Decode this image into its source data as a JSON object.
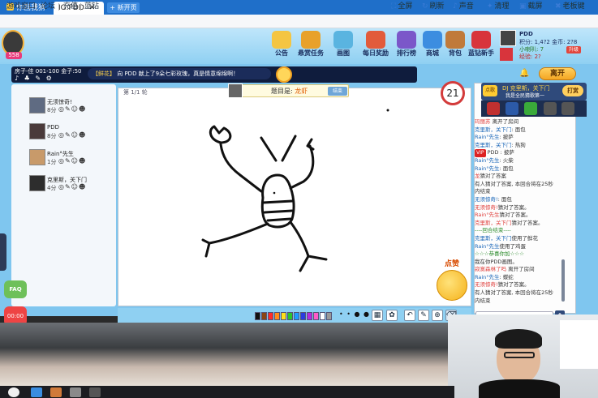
{
  "browser": {
    "tabs": [
      {
        "label": "你画我猜",
        "active": false
      },
      {
        "label": "IG.PDD",
        "active": true
      }
    ],
    "new_tab_label": "+ 新开页面"
  },
  "menubar": {
    "left_items": [
      "游戏窗口",
      "论坛",
      "充值",
      "蓝钻"
    ],
    "tools": [
      {
        "label": "全屏",
        "icon": "fullscreen-icon"
      },
      {
        "label": "刷新",
        "icon": "refresh-icon"
      },
      {
        "label": "声音",
        "icon": "sound-icon"
      },
      {
        "label": "清理",
        "icon": "broom-icon"
      },
      {
        "label": "截屏",
        "icon": "camera-icon"
      },
      {
        "label": "老板键",
        "icon": "boss-key-icon"
      }
    ]
  },
  "nav": {
    "items": [
      {
        "label": "公告",
        "color": "#f4c542"
      },
      {
        "label": "悬赏任务",
        "color": "#e8a12a"
      },
      {
        "label": "画图",
        "color": "#5ab4e0"
      },
      {
        "label": "每日奖励",
        "color": "#e25b3b"
      },
      {
        "label": "排行榜",
        "color": "#7b57c9"
      },
      {
        "label": "商城",
        "color": "#3c8de0"
      },
      {
        "label": "背包",
        "color": "#c07a3a"
      },
      {
        "label": "蓝钻新手",
        "color": "#d8343c"
      }
    ]
  },
  "avatar_tag": "558",
  "profile": {
    "name": "PDD",
    "line1": "积分: 1,4?2  金币: 2?8",
    "line2": "小喇叭: 7",
    "line3": "经验: 2?",
    "badge": "升级"
  },
  "room": {
    "info": "房子-佳 001-100 金子:50",
    "icons": "♪ ♣ ✎ ⚙"
  },
  "marquee": {
    "prefix": "【鲜花】",
    "text": "向 PDD 献上了9朵七彩玫瑰，真是情意绵绵啊！"
  },
  "leave_label": "离开",
  "players": [
    {
      "name": "无须惊奇!",
      "score": "8分",
      "ava": "#5f6b82"
    },
    {
      "name": "PDD",
      "score": "8分",
      "ava": "#4a3a3a"
    },
    {
      "name": "Rain°先生",
      "score": "1分",
      "ava": "#c89a6a"
    },
    {
      "name": "克里斯，关下门",
      "score": "4分",
      "ava": "#2d2d2d"
    }
  ],
  "player_tools": "◎✎☺☻",
  "canvas": {
    "round": "第 1/1 轮",
    "hint_prefix": "题目是: ",
    "hint_answer": "龙虾",
    "hint_button": "结束",
    "timer": "21"
  },
  "palette": [
    "#111111",
    "#8b4513",
    "#ff2a2a",
    "#ff8c1a",
    "#ffe01a",
    "#2bc52b",
    "#1e9bff",
    "#2a3de0",
    "#b52ae0",
    "#ff5ac8",
    "#ffffff",
    "#999999"
  ],
  "brush_dots": "• • ● ●",
  "tool_buttons": [
    "↶",
    "✎",
    "⊕",
    "⌫"
  ],
  "side": {
    "faq": "FAQ",
    "clock": "00:00"
  },
  "chat": {
    "header_name": "DJ 克里斯，关下门",
    "header_sub": "我是全民猜歌第一",
    "header_tag": "点歌",
    "gift_button": "打赏",
    "messages": [
      {
        "who": "玛丽苏",
        "text": "  离开了房间",
        "cls": "r"
      },
      {
        "who": "克里斯，关下门",
        "text": ": 面包",
        "cls": "n"
      },
      {
        "who": "Rain°先生",
        "text": ": 披萨",
        "cls": "n"
      },
      {
        "who": "克里斯，关下门",
        "text": ": 热狗",
        "cls": "n"
      },
      {
        "who": "VIP",
        "text": " PDD : 披萨",
        "cls": "vip"
      },
      {
        "who": "Rain°先生",
        "text": ": 火柴",
        "cls": "n"
      },
      {
        "who": "Rain°先生",
        "text": ": 面包",
        "cls": "n"
      },
      {
        "who": "龙",
        "text": "猜对了答案",
        "cls": "r"
      },
      {
        "who": "",
        "text": "有人猜对了答案, 本回合将在25秒",
        "cls": ""
      },
      {
        "who": "",
        "text": "内结束",
        "cls": ""
      },
      {
        "who": "无须惊奇!",
        "text": ": 面包",
        "cls": "n"
      },
      {
        "who": "无须惊奇!",
        "text": "猜对了答案。",
        "cls": "r"
      },
      {
        "who": "Rain°先生",
        "text": "猜对了答案。",
        "cls": "r"
      },
      {
        "who": "克里斯，关下门",
        "text": "猜对了答案。",
        "cls": "r"
      },
      {
        "who": "",
        "text": "----回合结束----",
        "cls": "g"
      },
      {
        "who": "克里斯，关下门",
        "text": "使用了鲜花",
        "cls": "n"
      },
      {
        "who": "Rain°先生",
        "text": "使用了鸡蛋",
        "cls": "n"
      },
      {
        "who": "",
        "text": "☆☆☆恭喜你加☆☆☆",
        "cls": "g"
      },
      {
        "who": "",
        "text": "我在你PDD画图。",
        "cls": "n"
      },
      {
        "who": "寂寞森林了吗",
        "text": "  离开了房间",
        "cls": "r"
      },
      {
        "who": "Rain°先生",
        "text": ": 蝶蛇",
        "cls": "n"
      },
      {
        "who": "无须惊奇!",
        "text": "猜对了答案。",
        "cls": "r"
      },
      {
        "who": "",
        "text": "有人猜对了答案, 本回合将在25秒",
        "cls": ""
      },
      {
        "who": "",
        "text": "内结束",
        "cls": ""
      }
    ],
    "like_label": "点赞",
    "send_label": "↑"
  }
}
